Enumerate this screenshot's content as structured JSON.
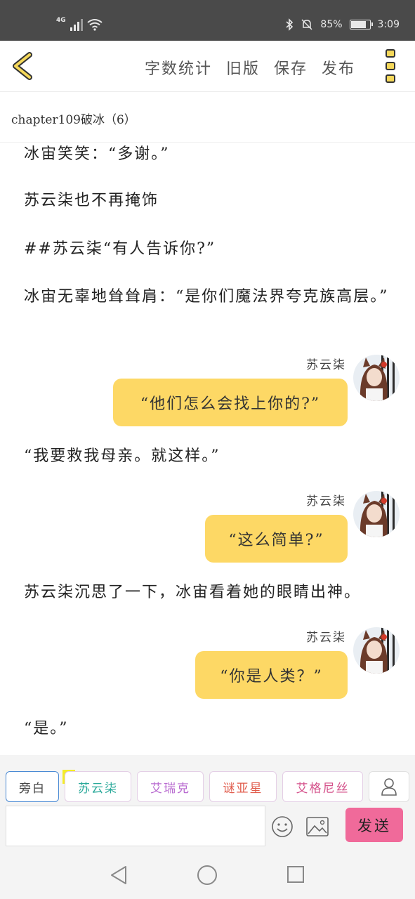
{
  "status": {
    "network": "4G",
    "battery": "85%",
    "time": "3:09",
    "battery_level": 0.85
  },
  "header": {
    "tools": [
      "字数统计",
      "旧版",
      "保存",
      "发布"
    ]
  },
  "chapter": {
    "title": "chapter109破冰（6）"
  },
  "story": {
    "lines": [
      "冰宙笑笑：“多谢。”",
      "苏云柒也不再掩饰",
      "##苏云柒“有人告诉你?”",
      "冰宙无辜地耸耸肩：“是你们魔法界夸克族高层。”",
      "“他们怎么会找上你的?”",
      "“我要救我母亲。就这样。”",
      "“这么简单?”",
      "苏云柒沉思了一下，冰宙看着她的眼睛出神。",
      "“你是人类？”",
      "“是。”"
    ],
    "speaker": "苏云柒"
  },
  "composer": {
    "roles": [
      "旁白",
      "苏云柒",
      "艾瑞克",
      "谜亚星",
      "艾格尼丝"
    ],
    "main_tag": "主",
    "input_value": "",
    "send_label": "发送"
  },
  "colors": {
    "bubble": "#fdd865",
    "send": "#f06a9a",
    "main_tag": "#f4ec28"
  }
}
